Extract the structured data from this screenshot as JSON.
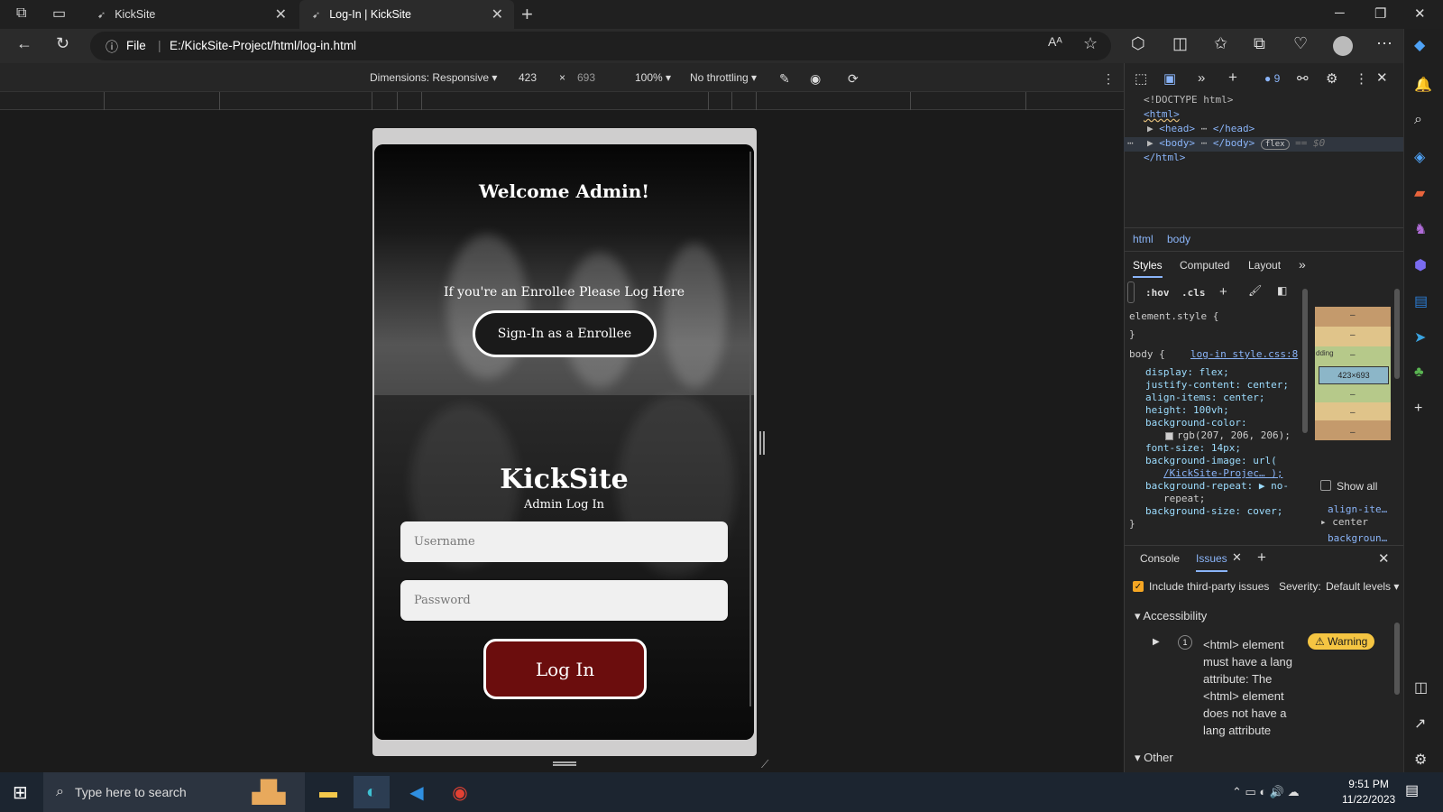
{
  "browser": {
    "tabs": [
      {
        "label": "KickSite"
      },
      {
        "label": "Log-In | KickSite"
      }
    ],
    "address": {
      "scheme_label": "File",
      "url": "E:/KickSite-Project/html/log-in.html"
    }
  },
  "device_toolbar": {
    "dimensions_label": "Dimensions: Responsive",
    "width": "423",
    "times": "×",
    "height": "693",
    "zoom": "100%",
    "throttling": "No throttling"
  },
  "page": {
    "welcome": "Welcome Admin!",
    "enrollee_prompt": "If you're an Enrollee Please Log Here",
    "enrollee_button": "Sign-In as a Enrollee",
    "brand": "KickSite",
    "subtitle": "Admin Log In",
    "username_placeholder": "Username",
    "password_placeholder": "Password",
    "login_button": "Log In"
  },
  "devtools": {
    "issue_count": "9",
    "elements": {
      "doctype": "<!DOCTYPE html>",
      "html_open": "<html>",
      "head": "<head>",
      "head_close": "</head>",
      "body": "<body>",
      "body_close": "</body>",
      "flex_badge": "flex",
      "eq": "== $0",
      "html_close": "</html>"
    },
    "breadcrumb": [
      "html",
      "body"
    ],
    "style_tabs": [
      "Styles",
      "Computed",
      "Layout"
    ],
    "filter_hov": ":hov",
    "filter_cls": ".cls",
    "element_style": "element.style {",
    "close_brace": "}",
    "rule_selector": "body {",
    "rule_source": "log-in style.css:8",
    "declarations": [
      "display: flex;",
      "justify-content: center;",
      "align-items: center;",
      "height: 100vh;",
      "background-color:",
      "rgb(207, 206, 206);",
      "font-size: 14px;",
      "background-image: url(",
      "/KickSite-Projec… );",
      "background-repeat: ▶ no-",
      "repeat;",
      "background-size: cover;"
    ],
    "box_model_size": "423×693",
    "box_padding_label": "dding",
    "box_dash": "–",
    "show_all": "Show all",
    "computed_prop": "align-ite…",
    "computed_value": "center",
    "computed_prop2": "backgroun…",
    "drawer_tabs": [
      "Console",
      "Issues"
    ],
    "include_third_party": "Include third-party issues",
    "severity_label": "Severity:",
    "severity_value": "Default levels",
    "section_accessibility": "Accessibility",
    "issue_count_badge": "1",
    "issue_text": "<html> element must have a lang attribute: The <html> element does not have a lang attribute",
    "issue_level": "Warning",
    "section_other": "Other"
  },
  "taskbar": {
    "search_placeholder": "Type here to search",
    "time": "9:51 PM",
    "date": "11/22/2023"
  }
}
